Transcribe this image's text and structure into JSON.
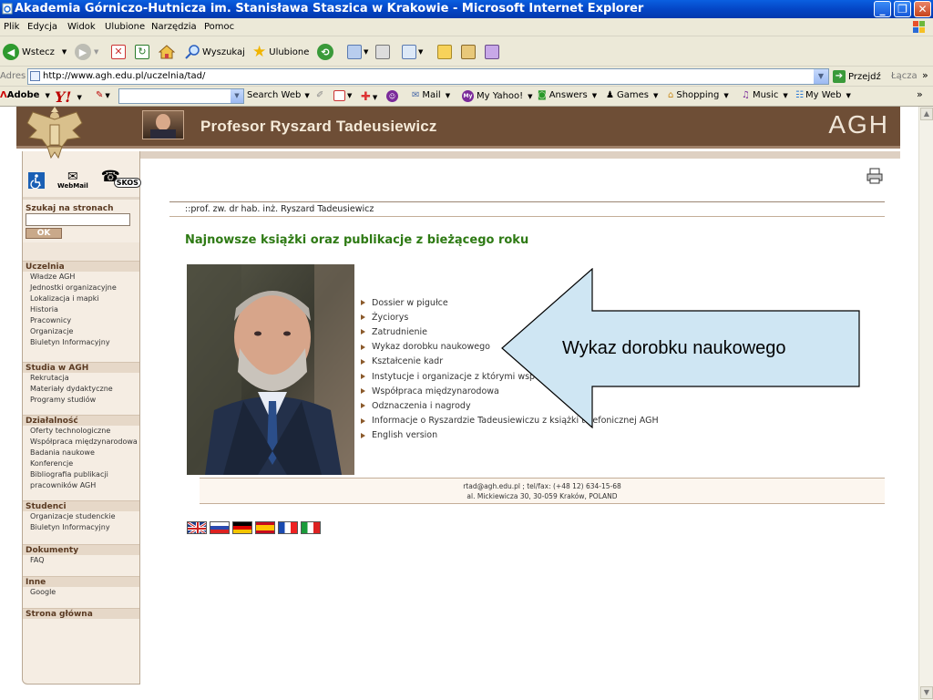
{
  "window": {
    "title": "Akademia Górniczo-Hutnicza im. Stanisława Staszica w Krakowie - Microsoft Internet Explorer",
    "minimize_label": "_",
    "maximize_label": "❐",
    "close_label": "✕"
  },
  "menu": [
    "Plik",
    "Edycja",
    "Widok",
    "Ulubione",
    "Narzędzia",
    "Pomoc"
  ],
  "toolbar": {
    "back_label": "Wstecz",
    "search_label": "Wyszukaj",
    "favorites_label": "Ulubione"
  },
  "address": {
    "label": "Adres",
    "url": "http://www.agh.edu.pl/uczelnia/tad/",
    "go_label": "Przejdź",
    "links_label": "Łącza",
    "more": "»"
  },
  "yahoo_bar": {
    "adobe_label": "Adobe",
    "yahoo_logo": "Y!",
    "search_web": "Search Web",
    "mail": "Mail",
    "my_yahoo": "My Yahoo!",
    "answers": "Answers",
    "games": "Games",
    "shopping": "Shopping",
    "music": "Music",
    "my_web": "My Web",
    "more": "»"
  },
  "banner": {
    "name": "Profesor  Ryszard Tadeusiewicz",
    "logo": "AGH"
  },
  "sidebar": {
    "webmail_label": "WebMail",
    "skos_label": "SKOS",
    "search_label": "Szukaj na stronach AGH:",
    "ok_label": "OK",
    "sections": [
      {
        "title": "Uczelnia",
        "items": [
          "Władze AGH",
          "Jednostki organizacyjne",
          "Lokalizacja i mapki",
          "Historia",
          "Pracownicy",
          "Organizacje",
          "Biuletyn Informacyjny"
        ]
      },
      {
        "title": "Studia w AGH",
        "items": [
          "Rekrutacja",
          "Materiały dydaktyczne",
          "Programy studiów"
        ]
      },
      {
        "title": "Działalność",
        "items": [
          "Oferty technologiczne",
          "Współpraca międzynarodowa",
          "Badania naukowe",
          "Konferencje",
          "Bibliografia publikacji",
          "pracowników AGH"
        ]
      },
      {
        "title": "Studenci",
        "items": [
          "Organizacje studenckie",
          "Biuletyn Informacyjny"
        ]
      },
      {
        "title": "Dokumenty",
        "items": [
          "FAQ"
        ]
      },
      {
        "title": "Inne",
        "items": [
          "Google"
        ]
      },
      {
        "title": "Strona główna",
        "items": []
      }
    ]
  },
  "content": {
    "breadcrumb": "::prof. zw. dr hab. inż. Ryszard Tadeusiewicz",
    "heading": "Najnowsze książki oraz publikacje z bieżącego roku",
    "links": [
      "Dossier w pigułce",
      "Życiorys",
      "Zatrudnienie",
      "Wykaz dorobku naukowego",
      "Kształcenie kadr",
      "Instytucje i organizacje z którymi współpracuje",
      "Współpraca międzynarodowa",
      "Odznaczenia i nagrody",
      "Informacje o Ryszardzie Tadeusiewiczu z książki telefonicznej AGH",
      "English version"
    ],
    "footer_line1": "rtad@agh.edu.pl ; tel/fax: (+48 12) 634-15-68",
    "footer_line2": "al. Mickiewicza 30, 30-059 Kraków, POLAND",
    "flags": [
      "english-flag",
      "russian-flag",
      "german-flag",
      "spanish-flag",
      "french-flag",
      "italian-flag"
    ]
  },
  "callout": {
    "text": "Wykaz dorobku naukowego",
    "fill": "#cfe6f3"
  }
}
